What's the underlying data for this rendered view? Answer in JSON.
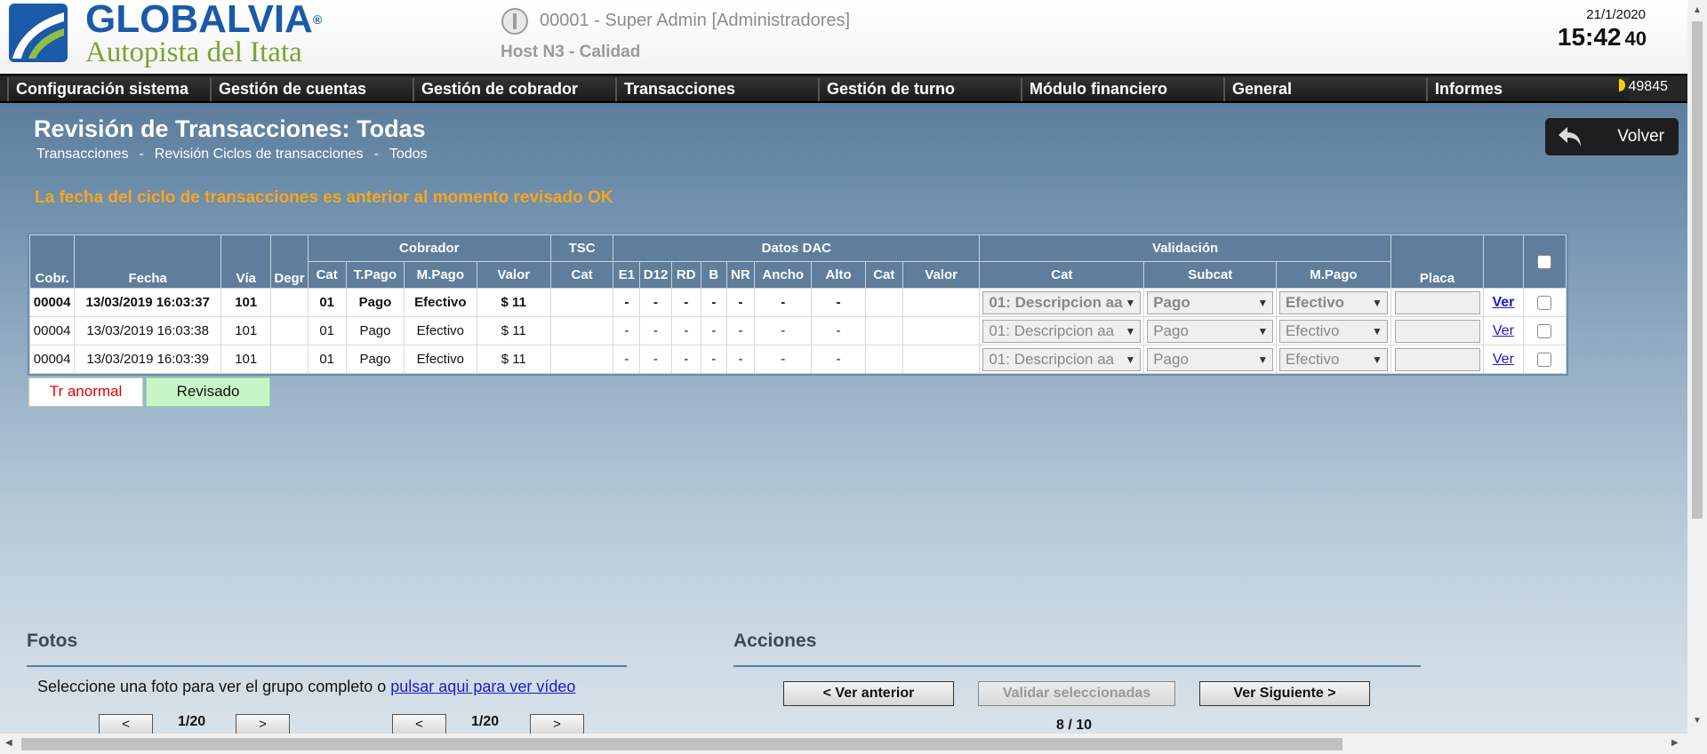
{
  "header": {
    "brand": "GLOBALVIA",
    "brand_mark": "®",
    "brand_sub": "Autopista del Itata",
    "user": "00001 - Super Admin [Administradores]",
    "host": "Host N3 - Calidad",
    "date": "21/1/2020",
    "time": "15:42",
    "seconds": "40"
  },
  "menu": {
    "items": [
      "Configuración sistema",
      "Gestión de cuentas",
      "Gestión de cobrador",
      "Transacciones",
      "Gestión de turno",
      "Módulo financiero",
      "General",
      "Informes"
    ],
    "counter": "49845"
  },
  "page": {
    "title": "Revisión de Transacciones: Todas",
    "breadcrumb": [
      "Transacciones",
      "Revisión Ciclos de transacciones",
      "Todos"
    ],
    "breadcrumb_sep": "-",
    "back_label": "Volver",
    "notice": "La fecha del ciclo de transacciones es anterior al momento revisado OK"
  },
  "table": {
    "groups": {
      "cobrador": "Cobrador",
      "tsc": "TSC",
      "dac": "Datos DAC",
      "validacion": "Validación"
    },
    "headers": {
      "cobr": "Cobr.",
      "fecha": "Fecha",
      "via": "Vía",
      "degr": "Degr",
      "cat": "Cat",
      "tpago": "T.Pago",
      "mpago": "M.Pago",
      "valor": "Valor",
      "tsc_cat": "Cat",
      "e1": "E1",
      "d12": "D12",
      "rd": "RD",
      "b": "B",
      "nr": "NR",
      "ancho": "Ancho",
      "alto": "Alto",
      "dac_cat": "Cat",
      "dac_valor": "Valor",
      "val_cat": "Cat",
      "val_subcat": "Subcat",
      "val_mpago": "M.Pago",
      "placa": "Placa"
    },
    "rows": [
      {
        "cobr": "00004",
        "fecha": "13/03/2019 16:03:37",
        "via": "101",
        "degr": "",
        "cat": "01",
        "tpago": "Pago",
        "mpago": "Efectivo",
        "valor": "$ 11",
        "tsc_cat": "",
        "e1": "-",
        "d12": "-",
        "rd": "-",
        "b": "-",
        "nr": "-",
        "ancho": "-",
        "alto": "-",
        "dac_cat": "",
        "dac_valor": "",
        "sel_cat": "01: Descripcion aa",
        "sel_subcat": "Pago",
        "sel_mpago": "Efectivo",
        "link": "Ver"
      },
      {
        "cobr": "00004",
        "fecha": "13/03/2019 16:03:38",
        "via": "101",
        "degr": "",
        "cat": "01",
        "tpago": "Pago",
        "mpago": "Efectivo",
        "valor": "$ 11",
        "tsc_cat": "",
        "e1": "-",
        "d12": "-",
        "rd": "-",
        "b": "-",
        "nr": "-",
        "ancho": "-",
        "alto": "-",
        "dac_cat": "",
        "dac_valor": "",
        "sel_cat": "01: Descripcion aa",
        "sel_subcat": "Pago",
        "sel_mpago": "Efectivo",
        "link": "Ver"
      },
      {
        "cobr": "00004",
        "fecha": "13/03/2019 16:03:39",
        "via": "101",
        "degr": "",
        "cat": "01",
        "tpago": "Pago",
        "mpago": "Efectivo",
        "valor": "$ 11",
        "tsc_cat": "",
        "e1": "-",
        "d12": "-",
        "rd": "-",
        "b": "-",
        "nr": "-",
        "ancho": "-",
        "alto": "-",
        "dac_cat": "",
        "dac_valor": "",
        "sel_cat": "01: Descripcion aa",
        "sel_subcat": "Pago",
        "sel_mpago": "Efectivo",
        "link": "Ver"
      }
    ]
  },
  "legend": {
    "abnormal": "Tr anormal",
    "reviewed": "Revisado"
  },
  "fotos": {
    "title": "Fotos",
    "hint": "Seleccione una foto para ver el grupo completo o",
    "video_link": "pulsar aqui para ver vídeo",
    "prev": "<",
    "next": ">",
    "pager1": "1/20",
    "pager2": "1/20"
  },
  "acciones": {
    "title": "Acciones",
    "prev": "< Ver anterior",
    "validate": "Validar seleccionadas",
    "next": "Ver Siguiente >",
    "counter": "8 / 10"
  },
  "colors": {
    "brand_blue": "#1a5aa8",
    "brand_green": "#7aa432",
    "notice": "#f5a623",
    "abnormal": "#e00000",
    "reviewed_bg": "#c8f5c8",
    "header_bg": "#5e7e9c"
  }
}
